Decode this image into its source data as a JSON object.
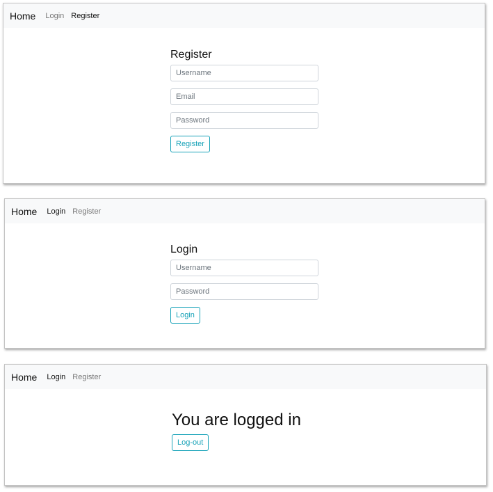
{
  "panels": [
    {
      "navbar": {
        "brand": "Home",
        "login": "Login",
        "register": "Register"
      },
      "title": "Register",
      "fields": [
        {
          "placeholder": "Username"
        },
        {
          "placeholder": "Email"
        },
        {
          "placeholder": "Password"
        }
      ],
      "button": "Register"
    },
    {
      "navbar": {
        "brand": "Home",
        "login": "Login",
        "register": "Register"
      },
      "title": "Login",
      "fields": [
        {
          "placeholder": "Username"
        },
        {
          "placeholder": "Password"
        }
      ],
      "button": "Login"
    },
    {
      "navbar": {
        "brand": "Home",
        "login": "Login",
        "register": "Register"
      },
      "title": "You are logged in",
      "button": "Log-out"
    }
  ],
  "colors": {
    "navbar_bg": "#f8f9fa",
    "button_accent": "#17a2b8",
    "input_border": "#ced4da"
  }
}
